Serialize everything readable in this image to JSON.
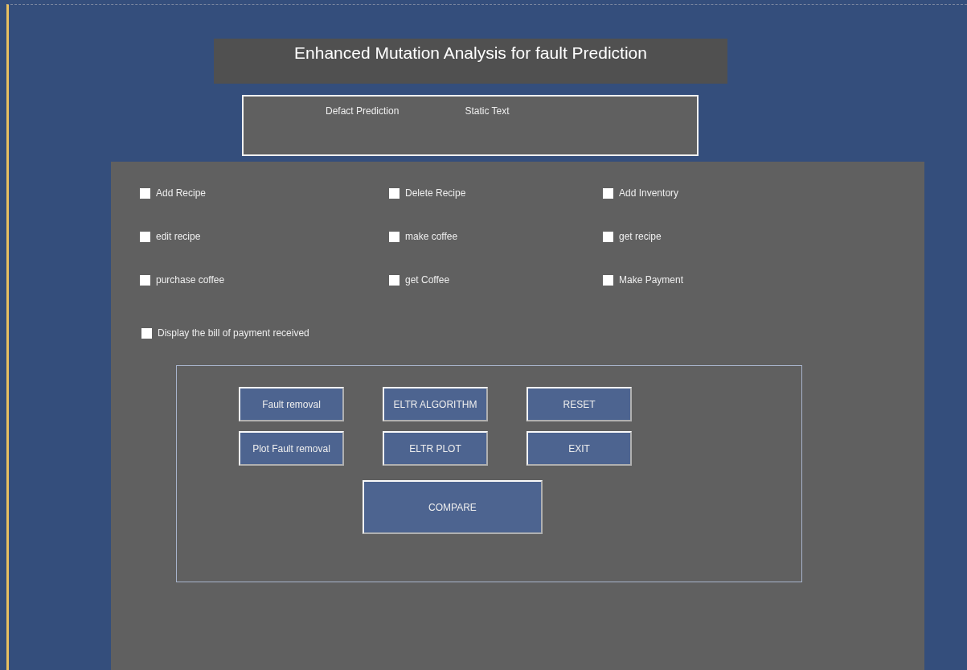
{
  "title": "Enhanced Mutation Analysis for fault Prediction",
  "static_texts": [
    "Defact Prediction",
    "Static Text"
  ],
  "checkboxes": [
    {
      "label": "Add Recipe",
      "checked": false
    },
    {
      "label": "Delete Recipe",
      "checked": false
    },
    {
      "label": "Add Inventory",
      "checked": false
    },
    {
      "label": "edit recipe",
      "checked": false
    },
    {
      "label": "make coffee",
      "checked": false
    },
    {
      "label": "get recipe",
      "checked": false
    },
    {
      "label": "purchase coffee",
      "checked": false
    },
    {
      "label": "get Coffee",
      "checked": false
    },
    {
      "label": "Make Payment",
      "checked": false
    },
    {
      "label": "Display the bill of payment received",
      "checked": false
    }
  ],
  "buttons": [
    "Fault removal",
    "ELTR ALGORITHM",
    "RESET",
    "Plot Fault removal",
    "ELTR PLOT",
    "EXIT"
  ],
  "compare_button": "COMPARE"
}
